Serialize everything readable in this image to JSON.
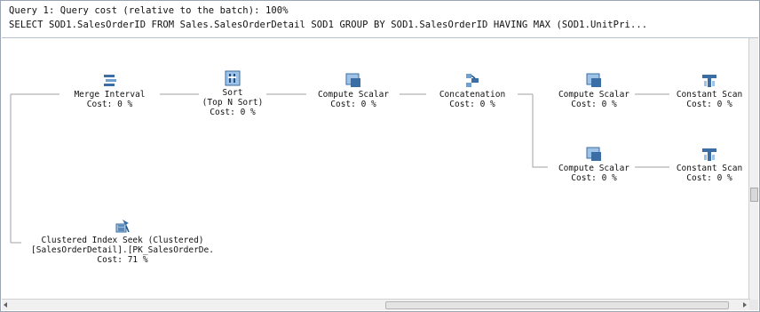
{
  "header": {
    "line1": "Query 1: Query cost (relative to the batch): 100%",
    "line2": "SELECT SOD1.SalesOrderID FROM Sales.SalesOrderDetail SOD1 GROUP BY SOD1.SalesOrderID HAVING MAX (SOD1.UnitPri..."
  },
  "nodes": {
    "merge_interval": {
      "name": "Merge Interval",
      "cost": "Cost: 0 %"
    },
    "sort": {
      "name": "Sort",
      "sub": "(Top N Sort)",
      "cost": "Cost: 0 %"
    },
    "compute_scalar_1": {
      "name": "Compute Scalar",
      "cost": "Cost: 0 %"
    },
    "concatenation": {
      "name": "Concatenation",
      "cost": "Cost: 0 %"
    },
    "compute_scalar_2": {
      "name": "Compute Scalar",
      "cost": "Cost: 0 %"
    },
    "constant_scan_1": {
      "name": "Constant Scan",
      "cost": "Cost: 0 %"
    },
    "compute_scalar_3": {
      "name": "Compute Scalar",
      "cost": "Cost: 0 %"
    },
    "constant_scan_2": {
      "name": "Constant Scan",
      "cost": "Cost: 0 %"
    },
    "clustered_index_seek": {
      "name": "Clustered Index Seek (Clustered)",
      "object": "[SalesOrderDetail].[PK_SalesOrderDe.",
      "cost": "Cost: 71 %"
    }
  },
  "icons": {
    "merge_interval": "merge-interval-icon",
    "sort": "sort-icon",
    "compute_scalar": "compute-scalar-icon",
    "concatenation": "concatenation-icon",
    "constant_scan": "constant-scan-icon",
    "clustered_index_seek": "clustered-index-seek-icon"
  },
  "colors": {
    "icon_blue": "#3a6ea5",
    "icon_light": "#9ec3e6",
    "edge": "#a0a0a0"
  }
}
